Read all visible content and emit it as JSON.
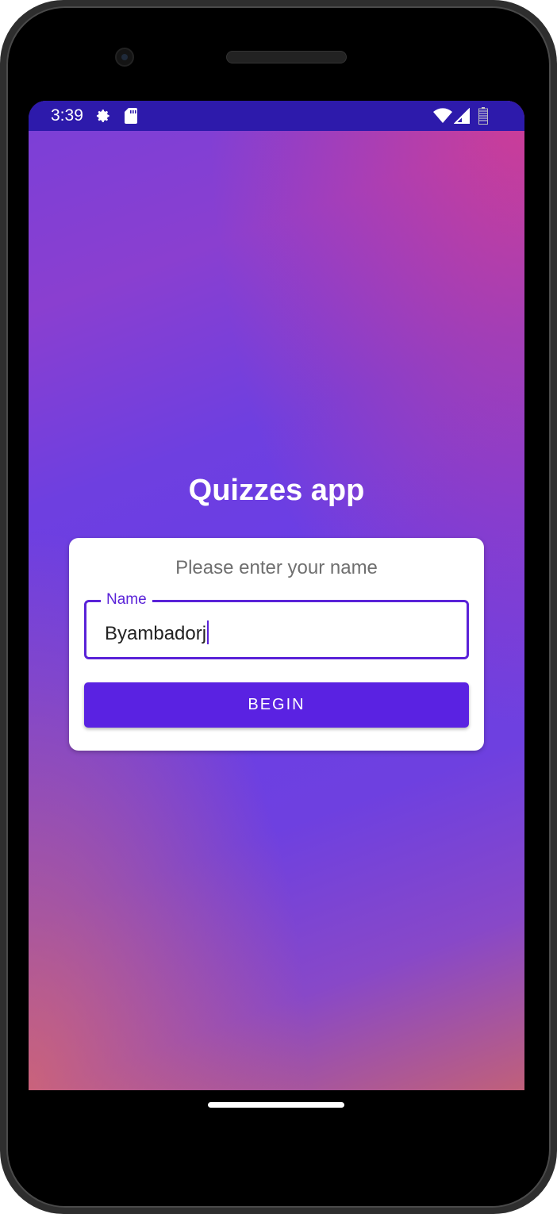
{
  "status_bar": {
    "time": "3:39",
    "icons": [
      "gear-icon",
      "sd-card-icon",
      "wifi-icon",
      "signal-icon",
      "battery-icon"
    ]
  },
  "app": {
    "title": "Quizzes app",
    "prompt": "Please enter your name",
    "name_field": {
      "label": "Name",
      "value": "Byambadorj"
    },
    "begin_label": "BEGIN"
  },
  "colors": {
    "status_bar": "#2d1aab",
    "accent": "#5a22e2",
    "card": "#ffffff"
  }
}
